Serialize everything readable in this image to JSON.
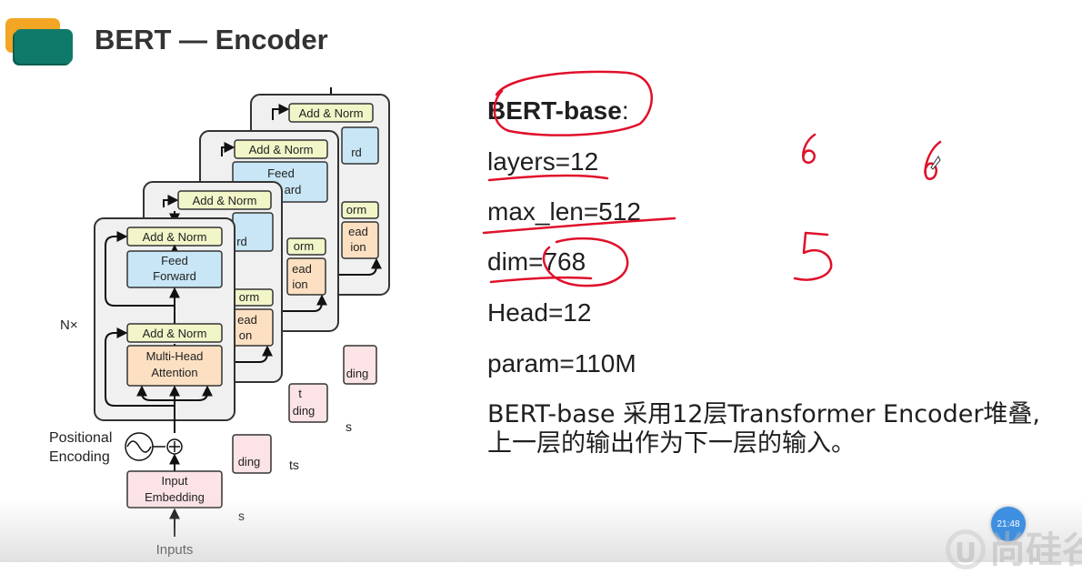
{
  "slide": {
    "title": "BERT — Encoder"
  },
  "diagram": {
    "add_norm": "Add & Norm",
    "feed_1": "Feed",
    "feed_2": "Forward",
    "mha_1": "Multi-Head",
    "mha_2": "Attention",
    "nx": "N×",
    "pos_1": "Positional",
    "pos_2": "Encoding",
    "embed_1": "Input",
    "embed_2": "Embedding",
    "inputs": "Inputs",
    "peek": {
      "rd": "rd",
      "rd2": "ard",
      "feed": "Feed",
      "orm": "orm",
      "rm": "rm",
      "ead": "ead",
      "on": "on",
      "ion": "ion",
      "ad": "ad",
      "ding": "ding",
      "t": "t",
      "ts": "ts",
      "s": "s"
    }
  },
  "config": {
    "name": "BERT-base",
    "name_suffix": ":",
    "layers": "layers=12",
    "max_len": "max_len=512",
    "dim": "dim=768",
    "head": "Head=12",
    "param": "param=110M"
  },
  "description": {
    "line1": "BERT-base 采用12层Transformer Encoder堆叠,",
    "line2": "上一层的输出作为下一层的输入。"
  },
  "annotations": {
    "n1": "6",
    "n2": "6",
    "n3": "5"
  },
  "overlay": {
    "timer": "21:48",
    "watermark_letter": "U",
    "watermark_text": "尚硅谷"
  },
  "colors": {
    "logo_orange": "#f3a623",
    "logo_teal": "#0f7a6a",
    "ink_red": "#e0102a",
    "add_norm": "#f2f5c8",
    "feed": "#c8e6f5",
    "attn": "#fde0c2",
    "embed": "#fbe3e6"
  }
}
